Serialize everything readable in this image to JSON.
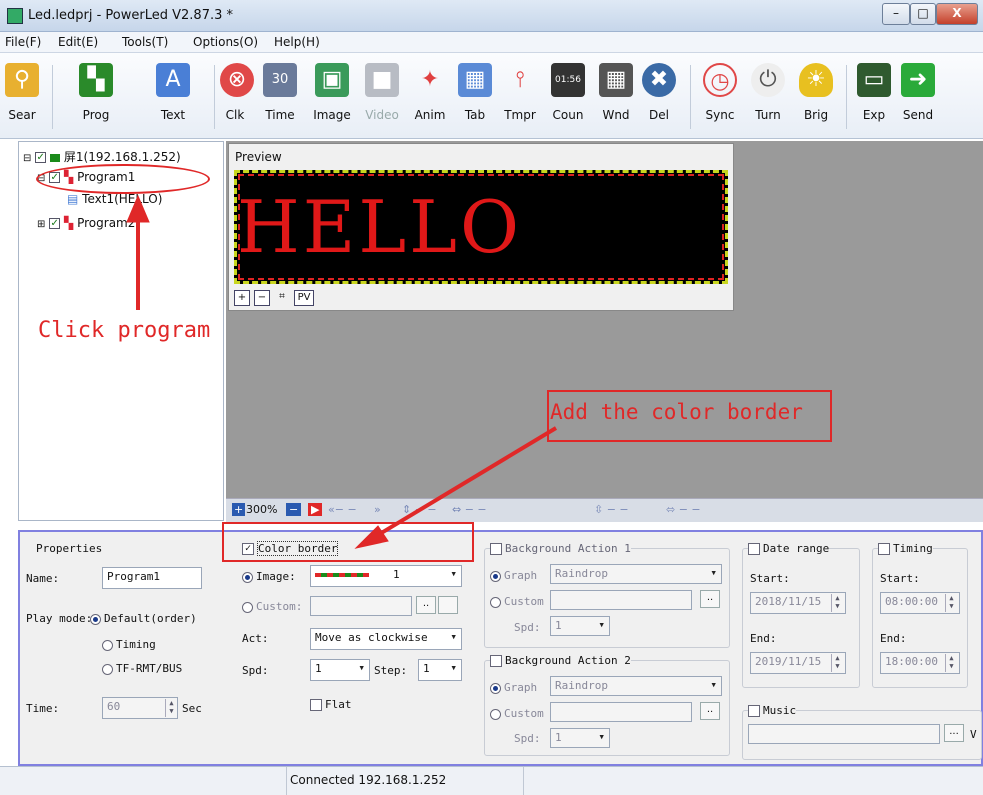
{
  "window": {
    "title": "Led.ledprj - PowerLed V2.87.3 *",
    "min": "–",
    "max": "□",
    "close": "X"
  },
  "menu": [
    "File(F)",
    "Edit(E)",
    "Tools(T)",
    "Options(O)",
    "Help(H)"
  ],
  "toolbar": [
    {
      "label": "Sear",
      "icon": "search-icon",
      "glyph": "⚲",
      "color": "#e8b030"
    },
    {
      "label": "Prog",
      "icon": "program-icon",
      "glyph": "▚",
      "color": "#2a8a2a"
    },
    {
      "label": "Text",
      "icon": "text-icon",
      "glyph": "A",
      "color": "#4a7fd6"
    },
    {
      "label": "Clk",
      "icon": "clock-icon",
      "glyph": "⊗",
      "color": "#e04848"
    },
    {
      "label": "Time",
      "icon": "calendar-icon",
      "glyph": "30",
      "color": "#6a7a9a"
    },
    {
      "label": "Image",
      "icon": "image-icon",
      "glyph": "▣",
      "color": "#3a9a5a"
    },
    {
      "label": "Video",
      "icon": "video-icon",
      "glyph": "■",
      "color": "#b8bcc4"
    },
    {
      "label": "Anim",
      "icon": "animation-icon",
      "glyph": "✦",
      "color": "#e04040"
    },
    {
      "label": "Tab",
      "icon": "table-icon",
      "glyph": "▦",
      "color": "#5a8ad6"
    },
    {
      "label": "Tmpr",
      "icon": "thermometer-icon",
      "glyph": "🌡",
      "color": "#e04040"
    },
    {
      "label": "Coun",
      "icon": "counter-icon",
      "glyph": "01:56",
      "color": "#333"
    },
    {
      "label": "Wnd",
      "icon": "window-icon",
      "glyph": "▦",
      "color": "#555"
    },
    {
      "label": "Del",
      "icon": "delete-icon",
      "glyph": "✖",
      "color": "#3a6aa6"
    },
    {
      "label": "Sync",
      "icon": "alarm-clock-icon",
      "glyph": "⏰",
      "color": "#e04848"
    },
    {
      "label": "Turn",
      "icon": "power-icon",
      "glyph": "⏻",
      "color": "#777"
    },
    {
      "label": "Brig",
      "icon": "bulb-icon",
      "glyph": "💡",
      "color": "#e8c020"
    },
    {
      "label": "Exp",
      "icon": "export-icon",
      "glyph": "▭",
      "color": "#3a6a3a"
    },
    {
      "label": "Send",
      "icon": "send-arrow-icon",
      "glyph": "➜",
      "color": "#2aaa3a"
    }
  ],
  "tree": {
    "screen": "屏1(192.168.1.252)",
    "program1": "Program1",
    "text1": "Text1(HELLO)",
    "program2": "Program2"
  },
  "preview": {
    "title": "Preview",
    "led_text": "HELLO",
    "pv": "PV"
  },
  "zoom": {
    "level": "300%"
  },
  "properties": {
    "title": "Properties",
    "name_label": "Name:",
    "name_value": "Program1",
    "play_mode_label": "Play mode:",
    "play_default": "Default(order)",
    "play_timing": "Timing",
    "play_tf": "TF-RMT/BUS",
    "time_label": "Time:",
    "time_value": "60",
    "time_unit": "Sec"
  },
  "color_border": {
    "label": "Color border",
    "image_label": "Image:",
    "image_value": "1",
    "custom_label": "Custom:",
    "act_label": "Act:",
    "act_value": "Move as clockwise",
    "spd_label": "Spd:",
    "spd_value": "1",
    "step_label": "Step:",
    "step_value": "1",
    "flat_label": "Flat"
  },
  "bg1": {
    "label": "Background Action 1",
    "graph": "Graph",
    "graph_value": "Raindrop",
    "custom": "Custom",
    "spd": "Spd:",
    "spd_value": "1"
  },
  "bg2": {
    "label": "Background Action 2",
    "graph": "Graph",
    "graph_value": "Raindrop",
    "custom": "Custom",
    "spd": "Spd:",
    "spd_value": "1"
  },
  "date_range": {
    "label": "Date range",
    "start_label": "Start:",
    "start_value": "2018/11/15",
    "end_label": "End:",
    "end_value": "2019/11/15"
  },
  "timing": {
    "label": "Timing",
    "start_label": "Start:",
    "start_value": "08:00:00",
    "end_label": "End:",
    "end_value": "18:00:00"
  },
  "music": {
    "label": "Music",
    "more": "...",
    "vol": "V"
  },
  "status": {
    "text": "Connected 192.168.1.252"
  },
  "annotations": {
    "click_program": "Click program",
    "add_border": "Add the color border",
    "color": "#e02828"
  }
}
